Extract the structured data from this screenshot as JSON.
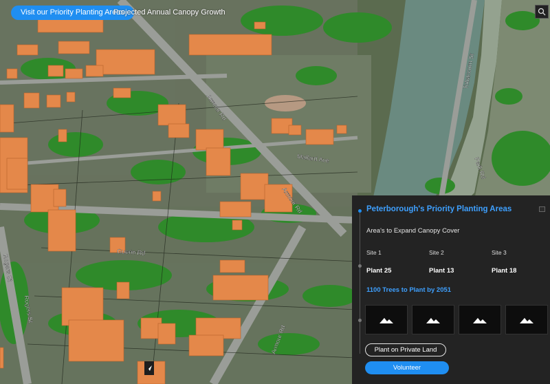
{
  "topbar": {
    "priority_button_label": "Visit our Priority Planting Areas",
    "growth_link_label": "Projected Annual Canopy Growth",
    "search_icon": "search-icon"
  },
  "map": {
    "street_labels": [
      "Mallard Ave",
      "Armour Rd",
      "Armour Rd",
      "Armour Rd",
      "Rogers St",
      "Rogers St",
      "Guerin Rd",
      "Tobaccorn St",
      "Park Rd"
    ]
  },
  "panel": {
    "title": "Peterborough's Priority Planting Areas",
    "subtitle": "Area's to Expand Canopy Cover",
    "sites": [
      {
        "label": "Site 1",
        "value": "Plant 25"
      },
      {
        "label": "Site 2",
        "value": "Plant 13"
      },
      {
        "label": "Site 3",
        "value": "Plant 18"
      }
    ],
    "goal": "1100 Trees to Plant by 2051",
    "thumbnail_icon": "image-placeholder-icon",
    "private_land_button": "Plant on Private Land",
    "volunteer_button": "Volunteer",
    "accent_color": "#1f8ef1"
  }
}
